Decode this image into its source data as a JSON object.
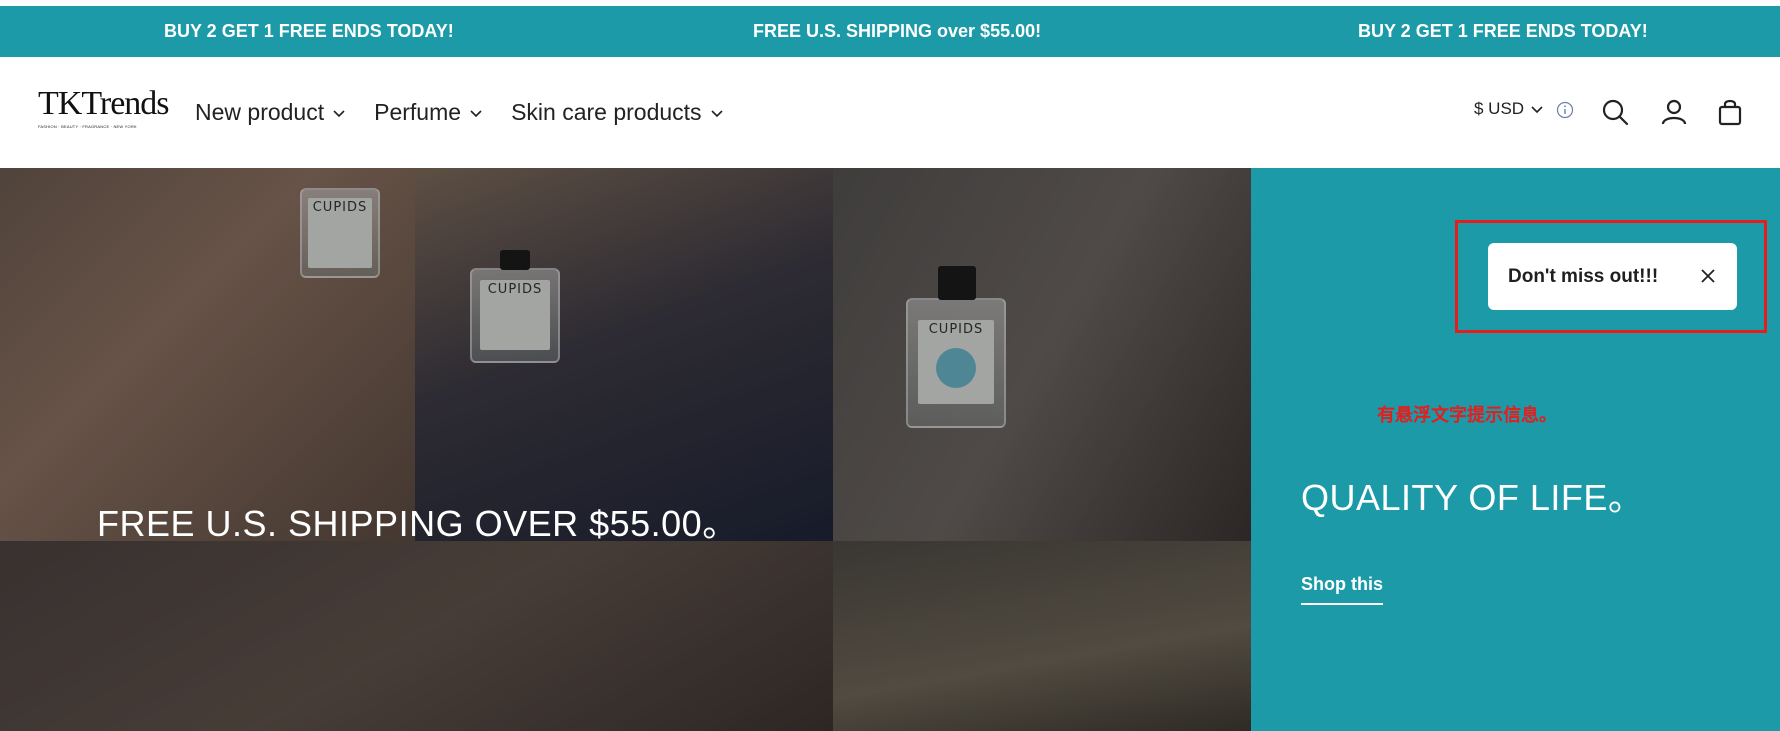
{
  "announcement_bar": {
    "messages": [
      "BUY 2 GET 1 FREE ENDS TODAY!",
      "FREE U.S. SHIPPING over $55.00!",
      "BUY 2 GET 1 FREE ENDS TODAY!"
    ],
    "background": "#1c9aa8"
  },
  "header": {
    "logo_text": "TKTrends",
    "logo_tagline": "FASHION · BEAUTY · FRAGRANCE · NEW YORK",
    "nav": [
      {
        "label": "New product",
        "icon": "chevron-down-icon"
      },
      {
        "label": "Perfume",
        "icon": "chevron-down-icon"
      },
      {
        "label": "Skin care products",
        "icon": "chevron-down-icon"
      }
    ],
    "currency": {
      "value": "$ USD",
      "icon": "chevron-down-icon"
    },
    "icons": [
      "info-icon",
      "search-icon",
      "account-icon",
      "cart-icon"
    ]
  },
  "hero": {
    "caption": "FREE U.S. SHIPPING OVER $55.00。",
    "bottle_brand": "CUPIDS"
  },
  "side_panel": {
    "background": "#1c9aa8",
    "toast": {
      "text": "Don't miss out!!!",
      "close_icon": "close-icon"
    },
    "annotation": "有悬浮文字提示信息。",
    "title": "QUALITY OF LIFE。",
    "link": "Shop this"
  },
  "accent_colors": {
    "teal": "#1c9aa8",
    "annotation_red": "#e51d1d"
  }
}
